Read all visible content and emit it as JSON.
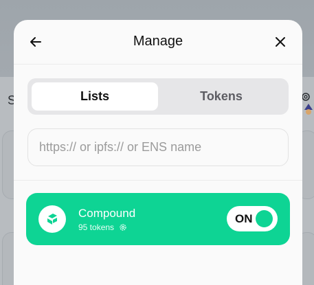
{
  "background": {
    "partial_label": "S",
    "accent": "#9ea5ab"
  },
  "modal": {
    "title": "Manage",
    "back_icon": "arrow-left-icon",
    "close_icon": "close-icon",
    "tabs": [
      {
        "label": "Lists",
        "active": true
      },
      {
        "label": "Tokens",
        "active": false
      }
    ],
    "search": {
      "placeholder": "https:// or ipfs:// or ENS name",
      "value": ""
    },
    "lists": [
      {
        "name": "Compound",
        "token_count": "95 tokens",
        "logo_icon": "compound-logo-icon",
        "settings_icon": "gear-icon",
        "toggle_label": "ON",
        "enabled": true,
        "color": "#0ed494"
      }
    ]
  }
}
